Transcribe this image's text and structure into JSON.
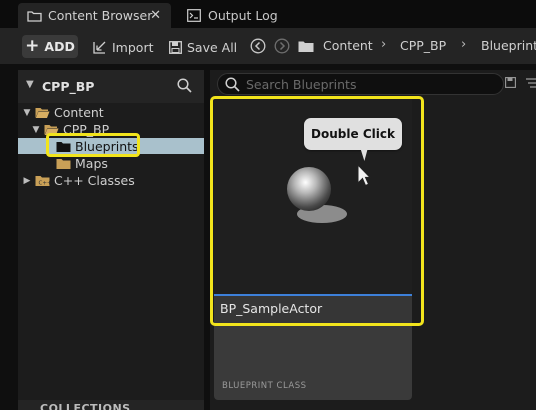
{
  "tabs": [
    {
      "label": "Content Browser",
      "icon": "folder-icon",
      "active": true
    },
    {
      "label": "Output Log",
      "icon": "terminal-icon",
      "active": false
    }
  ],
  "tab_close": "✕",
  "toolbar": {
    "add_label": "ADD",
    "import_label": "Import",
    "save_all_label": "Save All",
    "breadcrumb": [
      "Content",
      "CPP_BP",
      "Blueprints"
    ]
  },
  "sources": {
    "title": "CPP_BP",
    "tree": [
      {
        "label": "Content",
        "expanded": true
      },
      {
        "label": "CPP_BP",
        "expanded": true
      },
      {
        "label": "Blueprints",
        "selected": true
      },
      {
        "label": "Maps"
      },
      {
        "label": "C++ Classes",
        "expanded": false
      }
    ],
    "collections_label": "COLLECTIONS"
  },
  "search": {
    "placeholder": "Search Blueprints",
    "value": ""
  },
  "asset": {
    "name": "BP_SampleActor",
    "class_label": "BLUEPRINT CLASS"
  },
  "tooltip": {
    "text": "Double Click"
  },
  "colors": {
    "highlight": "#f2e41c",
    "selection": "#a9c1cc",
    "name_underline": "#3d80d9",
    "folder": "#c9a057"
  }
}
